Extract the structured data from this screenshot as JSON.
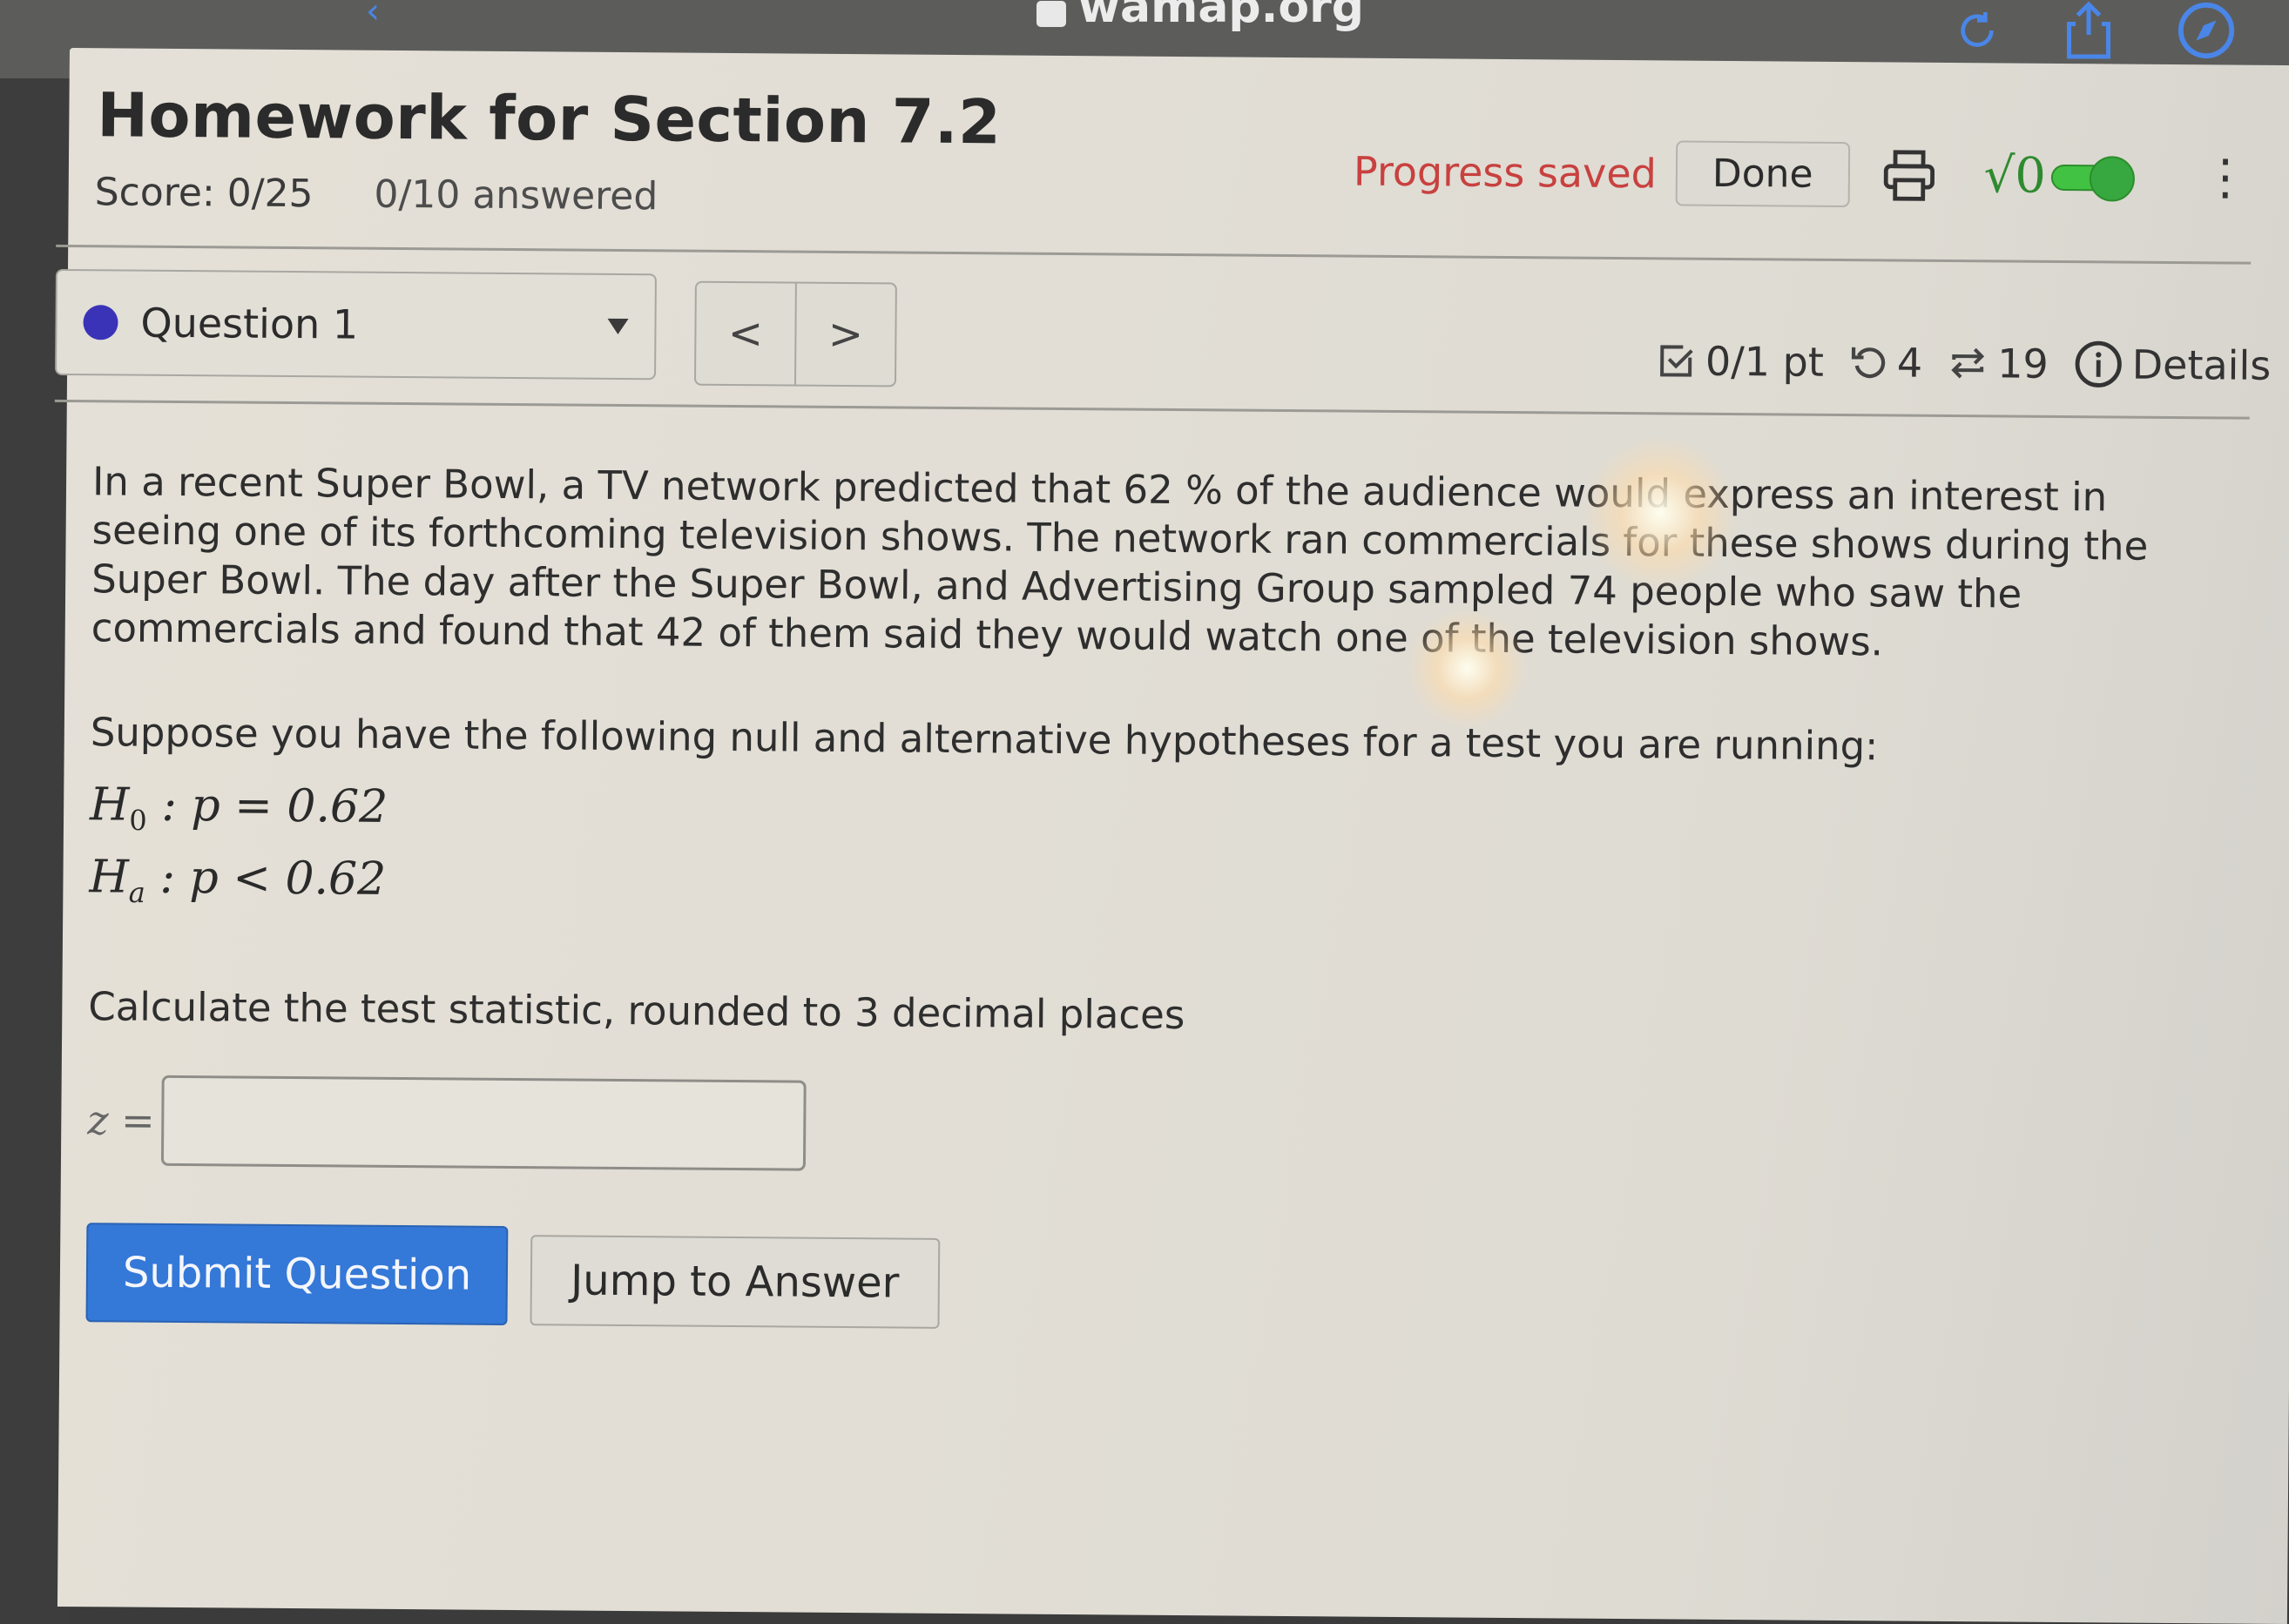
{
  "browser": {
    "url": "wamap.org",
    "icons": [
      "reload-icon",
      "share-icon",
      "compass-icon"
    ]
  },
  "header": {
    "title": "Homework for Section 7.2",
    "score": "Score: 0/25",
    "answered": "0/10 answered",
    "progress_status": "Progress saved",
    "done_label": "Done",
    "math_toggle_label": "√0",
    "math_toggle_on": true,
    "colors": {
      "progress_saved": "#c8413f",
      "toggle": "#36a83f"
    }
  },
  "question_nav": {
    "selected_question": "Question 1",
    "status_dot_color": "#3a33b8",
    "prev_label": "<",
    "next_label": ">"
  },
  "question_meta": {
    "points": "0/1 pt",
    "attempts": "4",
    "versions": "19",
    "details_label": "Details"
  },
  "question": {
    "text": "In a recent Super Bowl, a TV network predicted that 62 % of the audience would express an interest in seeing one of its forthcoming television shows. The network ran commercials for these shows during the Super Bowl. The day after the Super Bowl, and Advertising Group sampled 74 people who saw the commercials and found that 42 of them said they would watch one of the television shows.",
    "hypotheses_intro": "Suppose you have the following null and alternative hypotheses for a test you are running:",
    "h0": {
      "symbol": "H",
      "sub": "0",
      "rest": " : p = 0.62"
    },
    "ha": {
      "symbol": "H",
      "sub": "a",
      "rest": " : p < 0.62"
    },
    "prompt": "Calculate the test statistic, rounded to 3 decimal places",
    "answer_label": "z =",
    "answer_value": "",
    "submit_label": "Submit Question",
    "jump_label": "Jump to Answer",
    "submit_color": "#3478d8"
  }
}
